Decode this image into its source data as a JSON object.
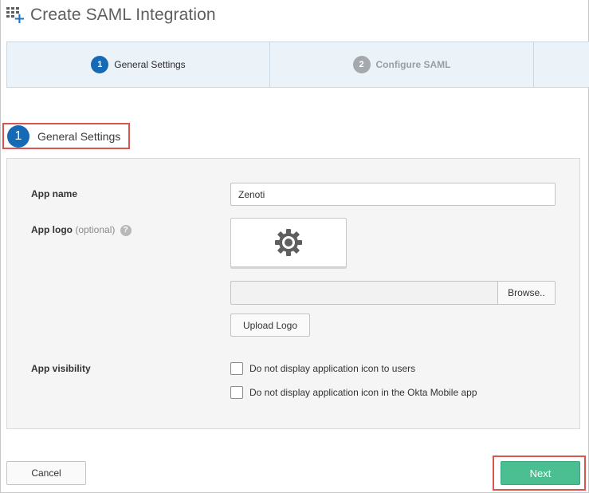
{
  "header": {
    "title": "Create SAML Integration",
    "icon": "add-app-icon"
  },
  "wizard": {
    "steps": [
      {
        "number": "1",
        "label": "General Settings",
        "state": "active"
      },
      {
        "number": "2",
        "label": "Configure SAML",
        "state": "inactive"
      }
    ]
  },
  "section": {
    "number": "1",
    "label": "General Settings"
  },
  "form": {
    "app_name": {
      "label": "App name",
      "value": "Zenoti"
    },
    "app_logo": {
      "label": "App logo",
      "optional": "(optional)",
      "help": "?",
      "icon": "gear-icon",
      "browse_label": "Browse..",
      "upload_label": "Upload Logo"
    },
    "app_visibility": {
      "label": "App visibility",
      "options": [
        {
          "label": "Do not display application icon to users",
          "checked": false
        },
        {
          "label": "Do not display application icon in the Okta Mobile app",
          "checked": false
        }
      ]
    }
  },
  "footer": {
    "cancel_label": "Cancel",
    "next_label": "Next"
  },
  "colors": {
    "primary": "#1669b5",
    "next_button": "#4cbf92",
    "highlight": "#d9534f",
    "wizard_bg": "#ebf3f8"
  }
}
